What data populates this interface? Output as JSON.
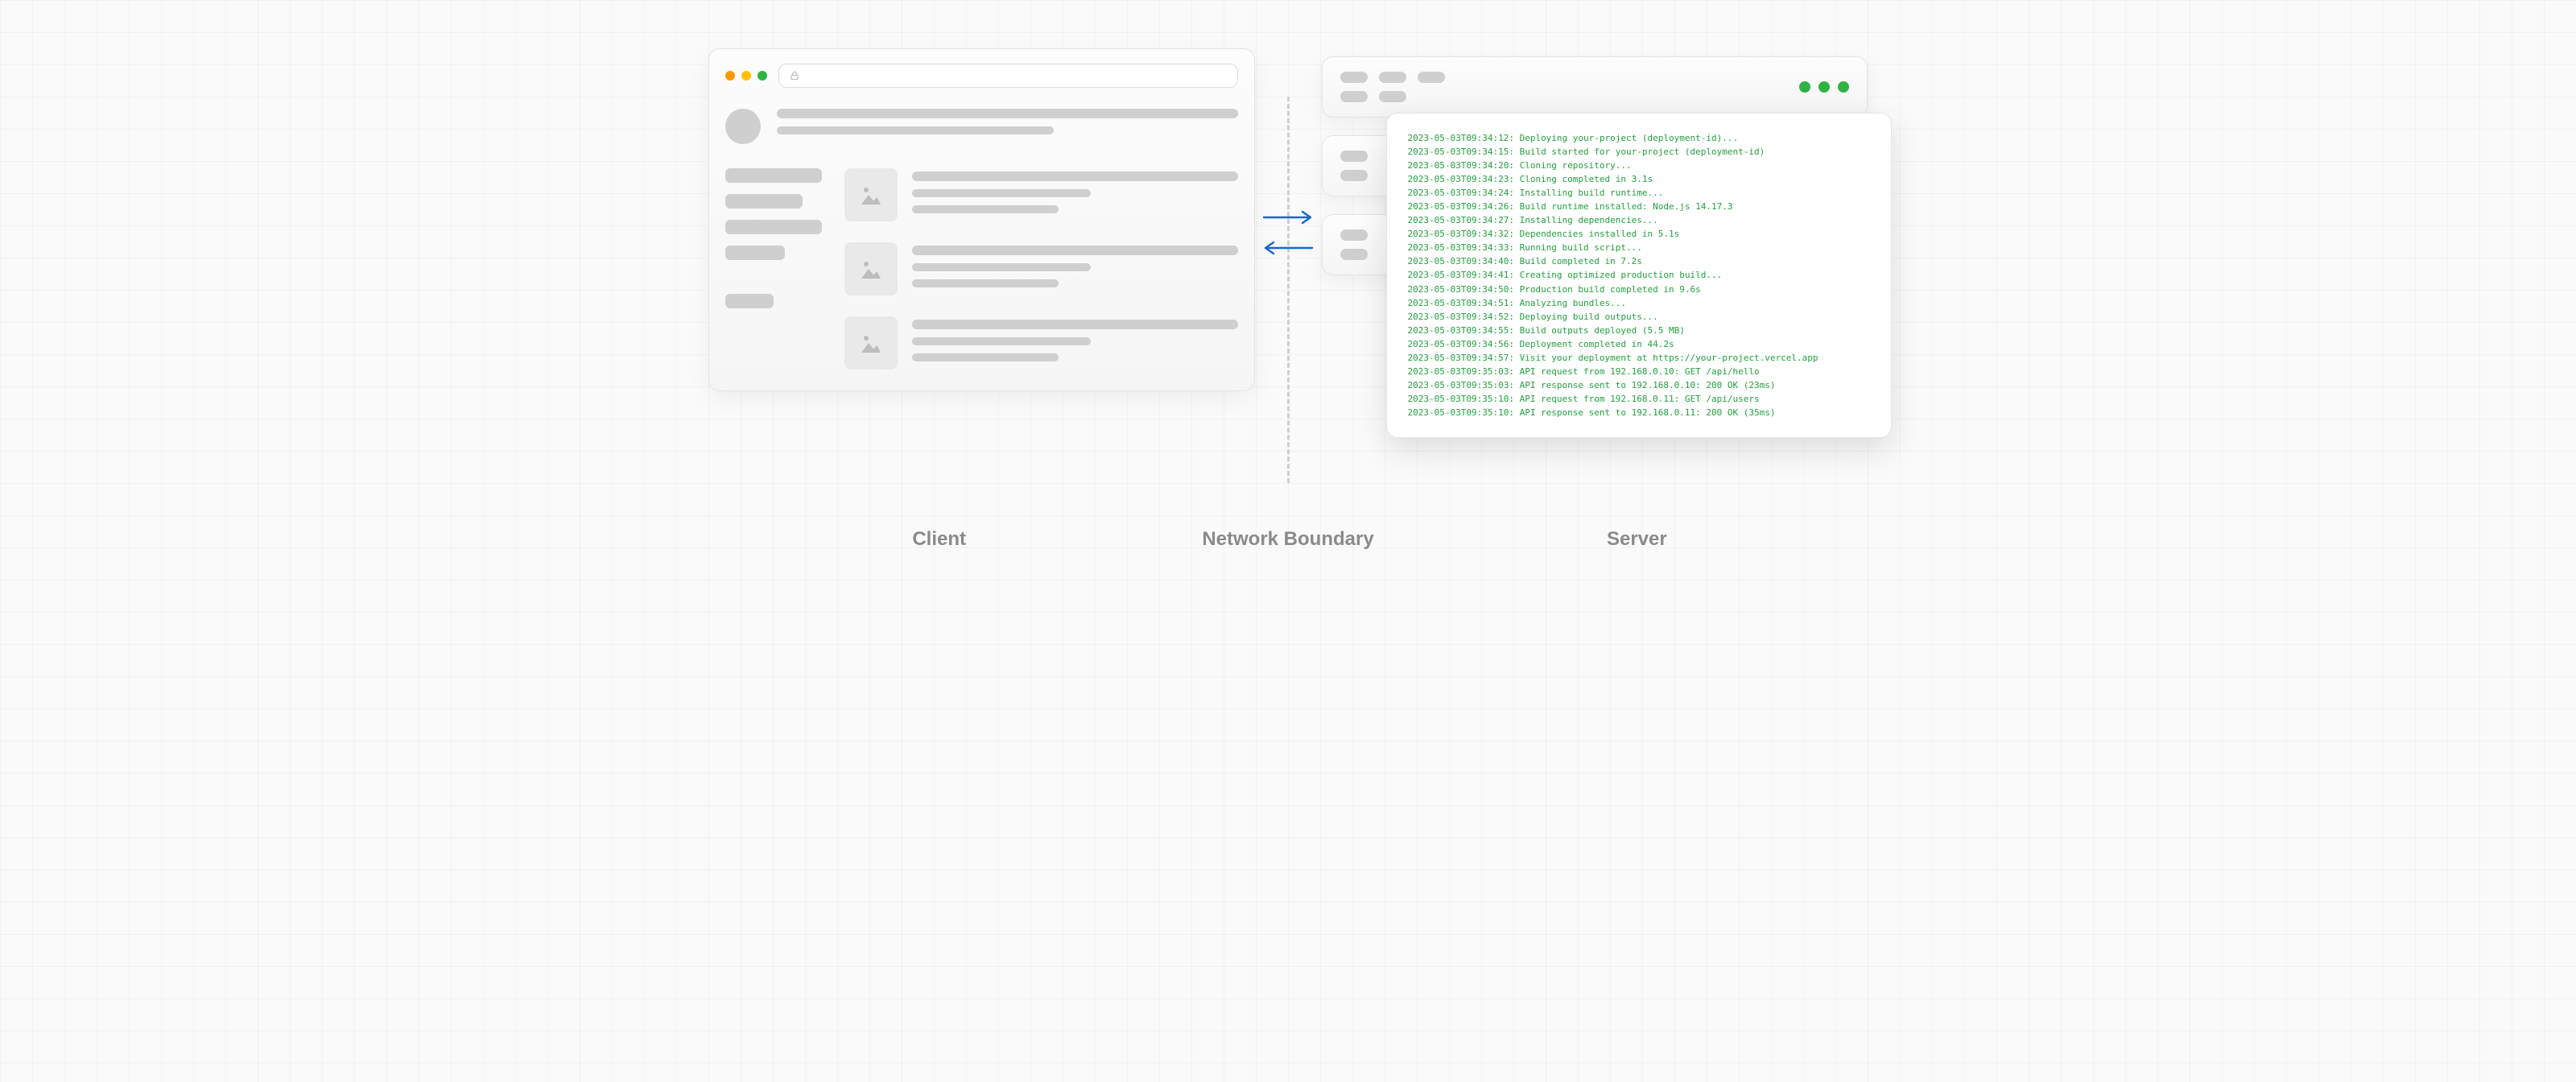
{
  "labels": {
    "client": "Client",
    "boundary": "Network Boundary",
    "server": "Server"
  },
  "colors": {
    "accent_green": "#2fb344",
    "arrow_blue": "#1366d6",
    "terminal_text": "#23a040"
  },
  "terminal": {
    "lines": [
      "2023-05-03T09:34:12: Deploying your-project (deployment-id)...",
      "2023-05-03T09:34:15: Build started for your-project (deployment-id)",
      "2023-05-03T09:34:20: Cloning repository...",
      "2023-05-03T09:34:23: Cloning completed in 3.1s",
      "2023-05-03T09:34:24: Installing build runtime...",
      "2023-05-03T09:34:26: Build runtime installed: Node.js 14.17.3",
      "2023-05-03T09:34:27: Installing dependencies...",
      "2023-05-03T09:34:32: Dependencies installed in 5.1s",
      "2023-05-03T09:34:33: Running build script...",
      "2023-05-03T09:34:40: Build completed in 7.2s",
      "2023-05-03T09:34:41: Creating optimized production build...",
      "2023-05-03T09:34:50: Production build completed in 9.6s",
      "2023-05-03T09:34:51: Analyzing bundles...",
      "2023-05-03T09:34:52: Deploying build outputs...",
      "2023-05-03T09:34:55: Build outputs deployed (5.5 MB)",
      "2023-05-03T09:34:56: Deployment completed in 44.2s",
      "2023-05-03T09:34:57: Visit your deployment at https://your-project.vercel.app",
      "2023-05-03T09:35:03: API request from 192.168.0.10: GET /api/hello",
      "2023-05-03T09:35:03: API response sent to 192.168.0.10: 200 OK (23ms)",
      "2023-05-03T09:35:10: API request from 192.168.0.11: GET /api/users",
      "2023-05-03T09:35:10: API response sent to 192.168.0.11: 200 OK (35ms)"
    ]
  }
}
